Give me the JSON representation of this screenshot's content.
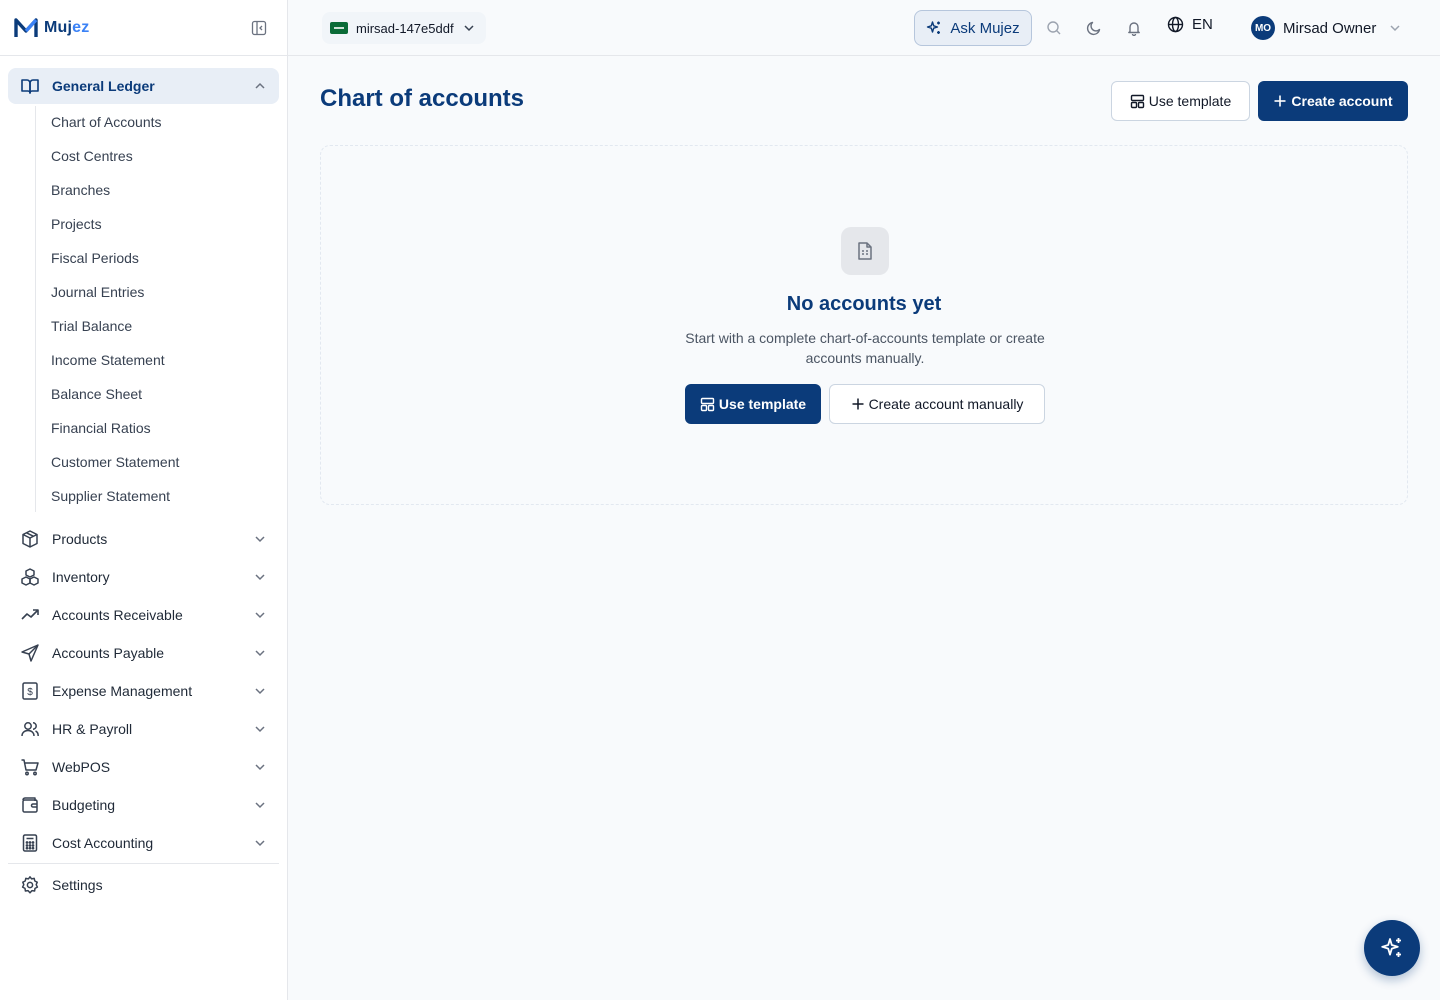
{
  "brand": {
    "name_main": "Muj",
    "name_accent": "ez"
  },
  "sidebar": {
    "active_group": {
      "label": "General Ledger",
      "icon": "book-open-icon",
      "items": [
        "Chart of Accounts",
        "Cost Centres",
        "Branches",
        "Projects",
        "Fiscal Periods",
        "Journal Entries",
        "Trial Balance",
        "Income Statement",
        "Balance Sheet",
        "Financial Ratios",
        "Customer Statement",
        "Supplier Statement"
      ]
    },
    "groups": [
      {
        "label": "Products",
        "icon": "package-icon"
      },
      {
        "label": "Inventory",
        "icon": "boxes-icon"
      },
      {
        "label": "Accounts Receivable",
        "icon": "trending-up-icon"
      },
      {
        "label": "Accounts Payable",
        "icon": "send-icon"
      },
      {
        "label": "Expense Management",
        "icon": "receipt-icon"
      },
      {
        "label": "HR & Payroll",
        "icon": "users-icon"
      },
      {
        "label": "WebPOS",
        "icon": "cart-icon"
      },
      {
        "label": "Budgeting",
        "icon": "wallet-icon"
      },
      {
        "label": "Cost Accounting",
        "icon": "calculator-icon"
      }
    ],
    "settings_label": "Settings"
  },
  "topbar": {
    "org_name": "mirsad-147e5ddf",
    "ask_label": "Ask Mujez",
    "language": "EN",
    "user_initials": "MO",
    "user_name": "Mirsad Owner"
  },
  "main": {
    "title": "Chart of accounts",
    "use_template_label": "Use template",
    "create_account_label": "Create account",
    "empty": {
      "title": "No accounts yet",
      "description": "Start with a complete chart-of-accounts template or create accounts manually.",
      "use_template_label": "Use template",
      "create_manual_label": "Create account manually"
    }
  },
  "colors": {
    "primary": "#0b3b7a",
    "accent": "#3b82f6",
    "active_bg": "#e8eef6"
  }
}
